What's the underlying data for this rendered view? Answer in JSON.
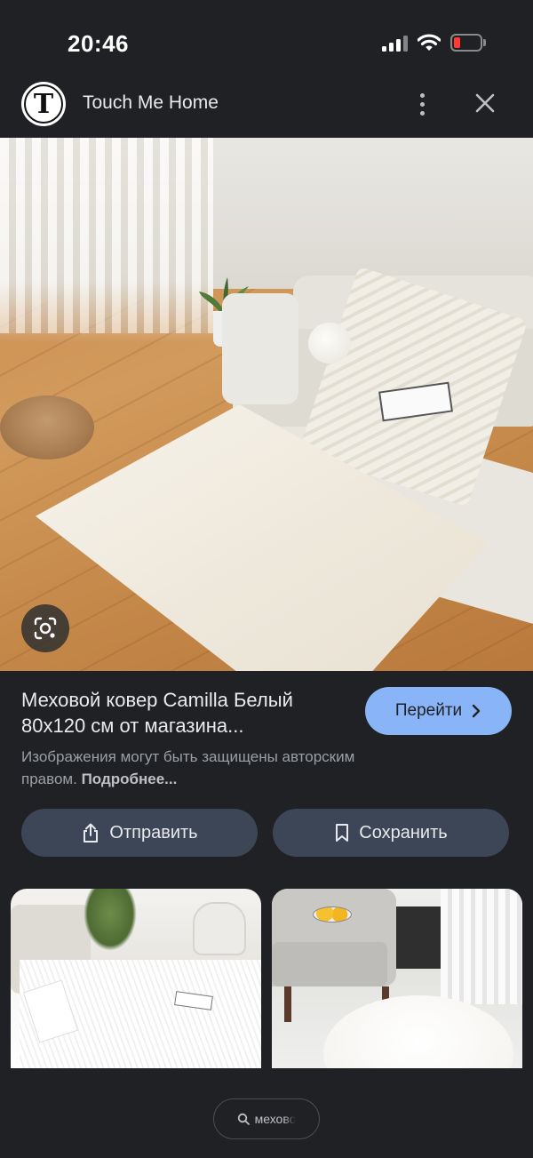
{
  "status_bar": {
    "time": "20:46",
    "battery_color": "#ff3b30"
  },
  "header": {
    "logo_letter": "T",
    "site_name": "Touch Me Home",
    "more_icon": "more-vert-icon",
    "close_icon": "close-icon"
  },
  "result": {
    "title": "Меховой ковер Camilla Белый 80x120 см от магазина...",
    "visit_label": "Перейти",
    "copyright_text": "Изображения могут быть защищены авторским правом.",
    "copyright_link": "Подробнее...",
    "accent_color": "#8ab4f8"
  },
  "actions": {
    "share_label": "Отправить",
    "save_label": "Сохранить"
  },
  "search_chip": {
    "text": "мехово"
  }
}
